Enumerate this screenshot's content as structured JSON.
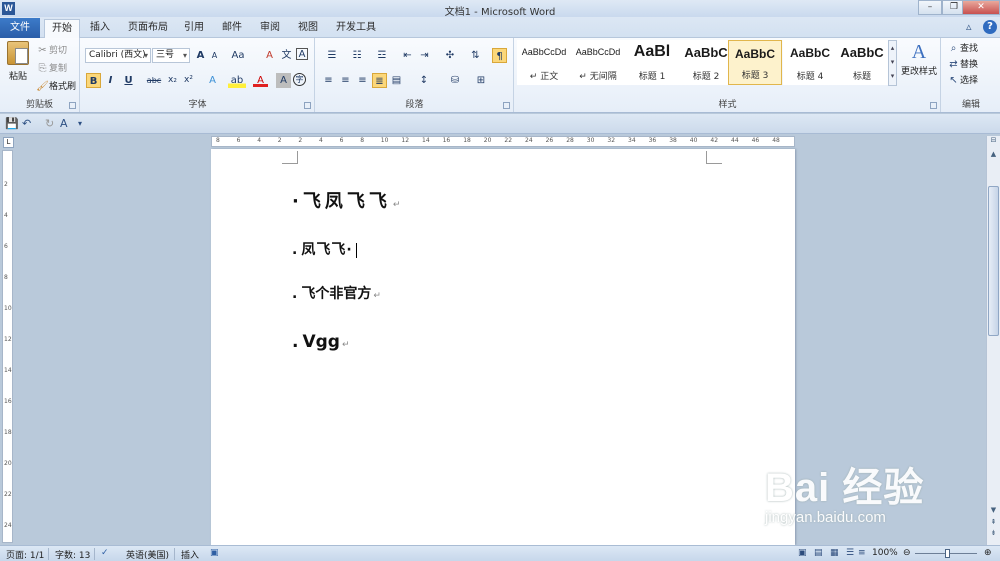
{
  "window": {
    "title": "文档1 - Microsoft Word",
    "app_icon": "W",
    "minimize": "–",
    "restore": "❐",
    "close": "✕"
  },
  "tabs": [
    {
      "label": "文件"
    },
    {
      "label": "开始"
    },
    {
      "label": "插入"
    },
    {
      "label": "页面布局"
    },
    {
      "label": "引用"
    },
    {
      "label": "邮件"
    },
    {
      "label": "审阅"
    },
    {
      "label": "视图"
    },
    {
      "label": "开发工具"
    }
  ],
  "ribbon": {
    "clipboard": {
      "label": "剪贴板",
      "paste": "粘贴",
      "cut": "剪切",
      "copy": "复制",
      "format_painter": "格式刷"
    },
    "font": {
      "label": "字体",
      "font_name": "Calibri (西文)",
      "font_size": "三号",
      "bold": "B",
      "italic": "I",
      "underline": "U",
      "strike": "abc",
      "subscript": "x₂",
      "superscript": "x²",
      "grow": "A",
      "shrink": "A",
      "case": "Aa",
      "clear": "A",
      "phonetic": "文",
      "border_char": "A",
      "font_color": "A",
      "highlight": "ab",
      "shade": "A",
      "enclose": "字"
    },
    "paragraph": {
      "label": "段落"
    },
    "styles": {
      "label": "样式",
      "items": [
        {
          "sample": "AaBbCcDd",
          "name": "↵ 正文"
        },
        {
          "sample": "AaBbCcDd",
          "name": "↵ 无间隔"
        },
        {
          "sample": "AaBl",
          "name": "标题 1"
        },
        {
          "sample": "AaBbC",
          "name": "标题 2"
        },
        {
          "sample": "AaBbC",
          "name": "标题 3"
        },
        {
          "sample": "AaBbC",
          "name": "标题 4"
        },
        {
          "sample": "AaBbC",
          "name": "标题"
        }
      ],
      "change_styles": "更改样式"
    },
    "editing": {
      "label": "编辑",
      "find": "查找",
      "replace": "替换",
      "select": "选择"
    }
  },
  "ruler": {
    "h_ticks": [
      "8",
      "6",
      "4",
      "2",
      "2",
      "4",
      "6",
      "8",
      "10",
      "12",
      "14",
      "16",
      "18",
      "20",
      "22",
      "24",
      "26",
      "28",
      "30",
      "32",
      "34",
      "36",
      "38",
      "40",
      "42",
      "44",
      "46",
      "48"
    ],
    "v_ticks": [
      "2",
      "4",
      "6",
      "8",
      "10",
      "12",
      "14",
      "16",
      "18",
      "20",
      "22",
      "24"
    ]
  },
  "document": {
    "lines": [
      {
        "bullet": "·",
        "text": "飞凤飞飞",
        "mark": "↵"
      },
      {
        "bullet": ".",
        "text": "凤飞飞·",
        "mark": ""
      },
      {
        "bullet": ".",
        "text": "飞个非官方",
        "mark": "↵"
      },
      {
        "bullet": ".",
        "text": "Vgg",
        "mark": "↵"
      }
    ]
  },
  "statusbar": {
    "page": "页面: 1/1",
    "words": "字数: 13",
    "language": "英语(美国)",
    "insert": "插入",
    "zoom": "100%"
  },
  "watermark": {
    "big": "Bai 经验",
    "small": "jingyan.baidu.com"
  }
}
